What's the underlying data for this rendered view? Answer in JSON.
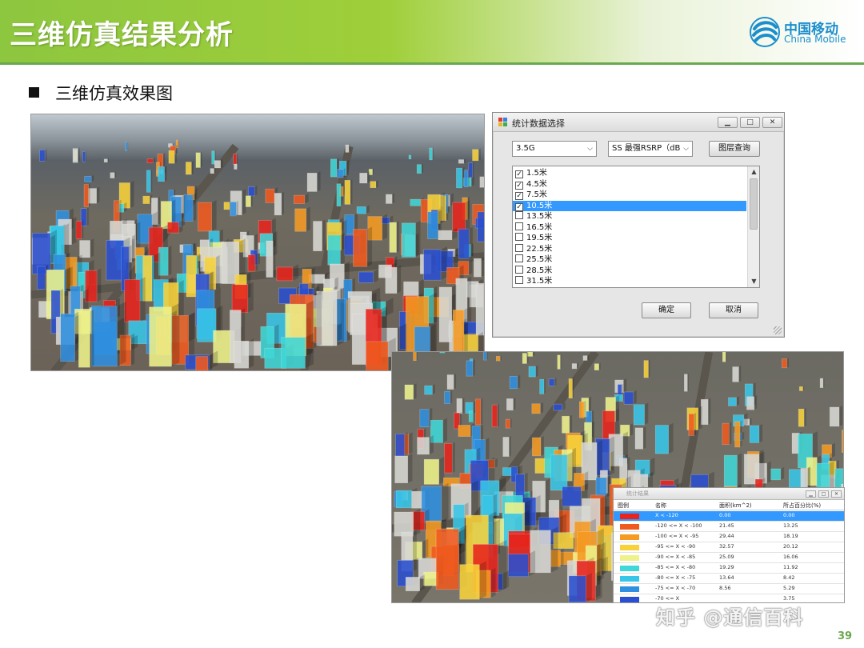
{
  "header": {
    "title": "三维仿真结果分析"
  },
  "logo": {
    "name_cn": "中国移动",
    "name_en": "China Mobile",
    "brand_color": "#1c8ecd"
  },
  "section": {
    "subtitle": "三维仿真效果图"
  },
  "dialog": {
    "title": "统计数据选择",
    "network_combo": "3.5G",
    "metric_combo": "SS 最强RSRP（dB",
    "query_button": "图层查询",
    "list_items": [
      {
        "label": "1.5米",
        "checked": true,
        "selected": false
      },
      {
        "label": "4.5米",
        "checked": true,
        "selected": false
      },
      {
        "label": "7.5米",
        "checked": true,
        "selected": false
      },
      {
        "label": "10.5米",
        "checked": true,
        "selected": true
      },
      {
        "label": "13.5米",
        "checked": false,
        "selected": false
      },
      {
        "label": "16.5米",
        "checked": false,
        "selected": false
      },
      {
        "label": "19.5米",
        "checked": false,
        "selected": false
      },
      {
        "label": "22.5米",
        "checked": false,
        "selected": false
      },
      {
        "label": "25.5米",
        "checked": false,
        "selected": false
      },
      {
        "label": "28.5米",
        "checked": false,
        "selected": false
      },
      {
        "label": "31.5米",
        "checked": false,
        "selected": false
      }
    ],
    "ok_button": "确定",
    "cancel_button": "取消"
  },
  "stats_window": {
    "title": "统计结果",
    "columns": [
      "图例",
      "名称",
      "面积(km^2)",
      "所占百分比(%)"
    ],
    "rows": [
      {
        "color": "#e8241c",
        "name": "X < -120",
        "area": "0.00",
        "percent": "0.00",
        "selected": true
      },
      {
        "color": "#f05a1e",
        "name": "-120 <= X < -100",
        "area": "21.45",
        "percent": "13.25",
        "selected": false
      },
      {
        "color": "#f59a22",
        "name": "-100 <= X < -95",
        "area": "29.44",
        "percent": "18.19",
        "selected": false
      },
      {
        "color": "#f8d23a",
        "name": "-95 <= X < -90",
        "area": "32.57",
        "percent": "20.12",
        "selected": false
      },
      {
        "color": "#eef28a",
        "name": "-90 <= X < -85",
        "area": "25.09",
        "percent": "16.06",
        "selected": false
      },
      {
        "color": "#3fd7d7",
        "name": "-85 <= X < -80",
        "area": "19.29",
        "percent": "11.92",
        "selected": false
      },
      {
        "color": "#38c6e8",
        "name": "-80 <= X < -75",
        "area": "13.64",
        "percent": "8.42",
        "selected": false
      },
      {
        "color": "#2f8fe0",
        "name": "-75 <= X < -70",
        "area": "8.56",
        "percent": "5.29",
        "selected": false
      },
      {
        "color": "#2a4fd0",
        "name": "-70 <= X",
        "area": "",
        "percent": "3.75",
        "selected": false
      }
    ]
  },
  "watermark": "知乎 @通信百科",
  "page_number": "39"
}
